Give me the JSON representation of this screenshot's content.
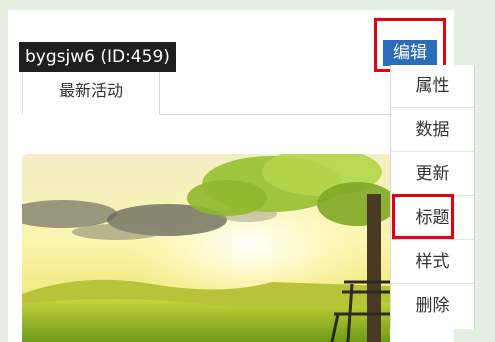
{
  "user": {
    "label": "bygsjw6 (ID:459)"
  },
  "tabs": [
    {
      "label": "最新活动"
    }
  ],
  "edit_button": {
    "label": "编辑"
  },
  "menu": {
    "items": [
      {
        "label": "属性"
      },
      {
        "label": "数据"
      },
      {
        "label": "更新"
      },
      {
        "label": "标题",
        "highlighted": true
      },
      {
        "label": "样式"
      },
      {
        "label": "删除"
      }
    ]
  },
  "colors": {
    "page_background": "#e4efe2",
    "accent_blue": "#2b6dbb",
    "highlight_red": "#e60012",
    "label_background": "#1f1f1f"
  },
  "image": {
    "subject": "landscape-with-tree-and-bench"
  }
}
